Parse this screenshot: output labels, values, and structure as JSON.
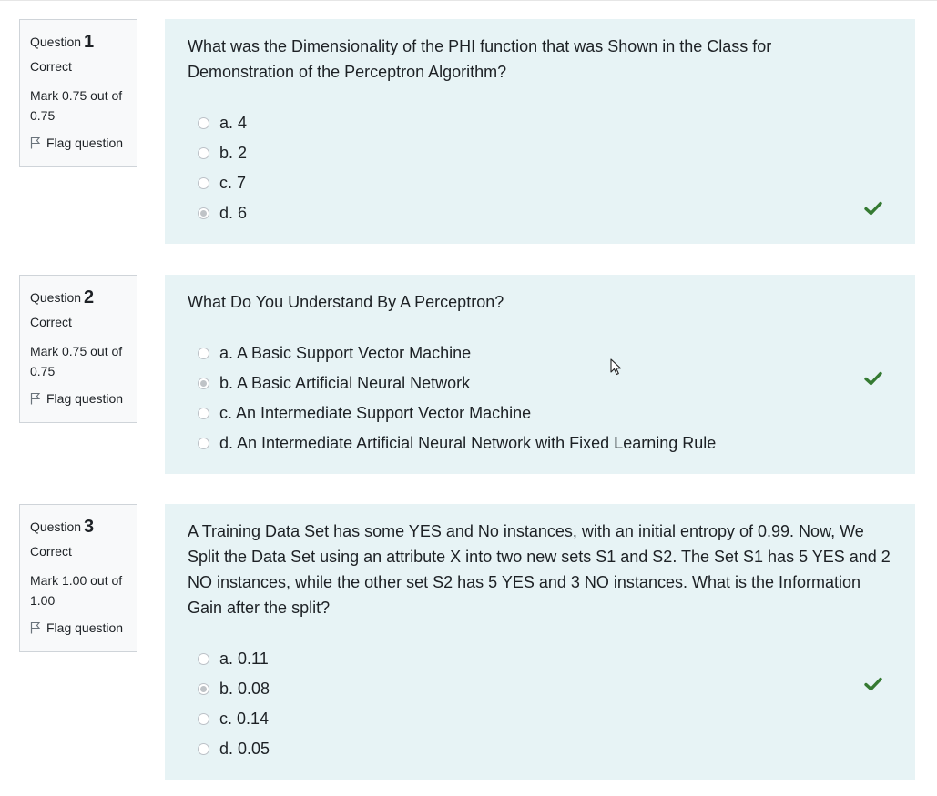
{
  "colors": {
    "panel_bg": "#e7f3f5",
    "info_bg": "#f8f9fa",
    "correct_check": "#357a32"
  },
  "questions": [
    {
      "label": "Question",
      "number": "1",
      "state": "Correct",
      "mark": "Mark 0.75 out of 0.75",
      "flag_label": "Flag question",
      "text": "What was the Dimensionality of the PHI function that was Shown in the Class for Demonstration of the Perceptron Algorithm?",
      "options": [
        {
          "label": "a. 4"
        },
        {
          "label": "b. 2"
        },
        {
          "label": "c. 7"
        },
        {
          "label": "d. 6"
        }
      ],
      "selected_index": 3,
      "feedback_icon": "check-icon"
    },
    {
      "label": "Question",
      "number": "2",
      "state": "Correct",
      "mark": "Mark 0.75 out of 0.75",
      "flag_label": "Flag question",
      "text": "What Do You Understand By A Perceptron?",
      "options": [
        {
          "label": "a. A Basic Support Vector Machine"
        },
        {
          "label": "b. A Basic Artificial Neural Network"
        },
        {
          "label": "c. An Intermediate Support Vector Machine"
        },
        {
          "label": "d. An Intermediate Artificial Neural Network with Fixed Learning Rule"
        }
      ],
      "selected_index": 1,
      "feedback_icon": "check-icon"
    },
    {
      "label": "Question",
      "number": "3",
      "state": "Correct",
      "mark": "Mark 1.00 out of 1.00",
      "flag_label": "Flag question",
      "text": "A Training Data Set has some YES and No instances, with an initial entropy of 0.99. Now, We Split the Data Set using an attribute X into two new sets S1 and S2. The Set S1 has 5 YES and 2 NO instances, while the other set S2 has 5 YES and 3 NO instances. What is the Information Gain after the split?",
      "options": [
        {
          "label": "a. 0.11"
        },
        {
          "label": "b. 0.08"
        },
        {
          "label": "c. 0.14"
        },
        {
          "label": "d. 0.05"
        }
      ],
      "selected_index": 1,
      "feedback_icon": "check-icon"
    }
  ]
}
